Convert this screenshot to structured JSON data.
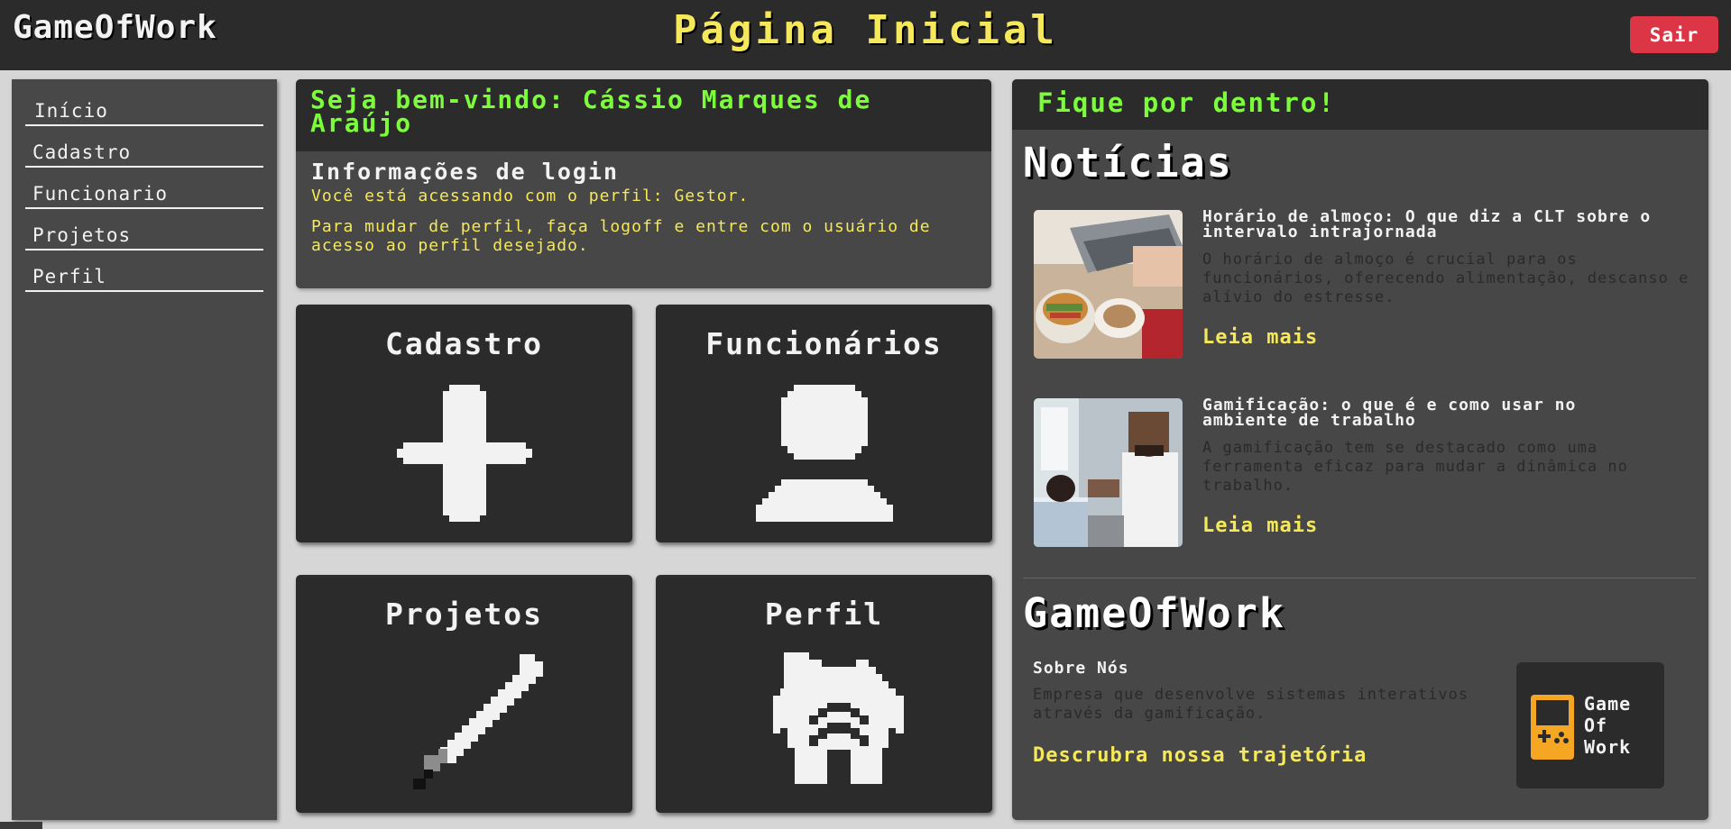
{
  "header": {
    "brand": "GameOfWork",
    "title": "Página Inicial",
    "logout_label": "Sair"
  },
  "sidebar": {
    "items": [
      {
        "label": "Início"
      },
      {
        "label": "Cadastro"
      },
      {
        "label": "Funcionario"
      },
      {
        "label": "Projetos"
      },
      {
        "label": "Perfil"
      }
    ]
  },
  "welcome": {
    "heading": "Seja bem-vindo: Cássio Marques de Araújo",
    "subtitle": "Informações de login",
    "profile_line": "Você está acessando com o perfil: Gestor.",
    "instructions": "Para mudar de perfil, faça logoff e entre com o usuário de acesso ao perfil desejado."
  },
  "tiles": {
    "cadastro": "Cadastro",
    "funcionarios": "Funcionários",
    "projetos": "Projetos",
    "perfil": "Perfil"
  },
  "news": {
    "header": "Fique por dentro!",
    "section_title": "Notícias",
    "articles": [
      {
        "title": "Horário de almoço: O que diz a CLT sobre o intervalo intrajornada",
        "summary": "O horário de almoço é crucial para os funcionários, oferecendo alimentação, descanso e alívio do estresse.",
        "link": "Leia mais"
      },
      {
        "title": "Gamificação: o que é e como usar no ambiente de trabalho",
        "summary": "A gamificação tem se destacado como uma ferramenta eficaz para mudar a dinâmica no trabalho.",
        "link": "Leia mais"
      }
    ],
    "about_title": "GameOfWork",
    "about_label": "Sobre Nós",
    "about_text": "Empresa que desenvolve sistemas interativos através da gamificação.",
    "discover_link": "Descrubra nossa trajetória",
    "logo_lines": [
      "Game",
      "Of",
      "Work"
    ]
  },
  "colors": {
    "accent_yellow": "#f5e85a",
    "accent_green": "#7cfc3a",
    "danger_red": "#dc3545",
    "panel_dark": "#2b2b2b",
    "panel_mid": "#474747"
  }
}
